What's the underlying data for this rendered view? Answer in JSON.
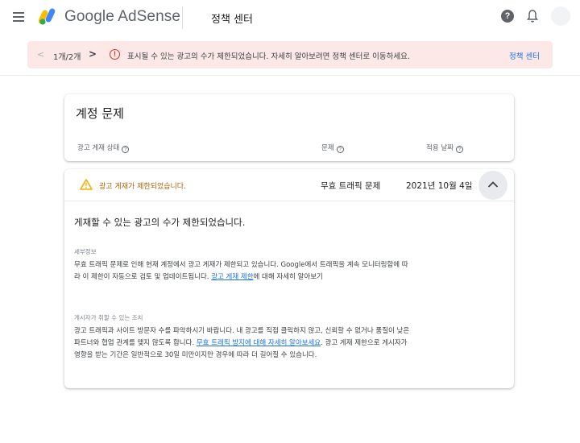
{
  "header": {
    "brand": "Google AdSense",
    "section": "정책 센터"
  },
  "alert": {
    "prev": "<",
    "count": "1개/2개",
    "next": ">",
    "info_symbol": "!",
    "message": "표시될 수 있는 광고의 수가 제한되었습니다. 자세히 알아보려면 정책 센터로 이동하세요.",
    "link": "정책 센터"
  },
  "account_issues": {
    "title": "계정 문제",
    "columns": {
      "status": "광고 게재 상태",
      "issue": "문제",
      "date": "적용 날짜"
    }
  },
  "issue_row": {
    "status": "광고 게재가 제한되었습니다.",
    "issue": "무효 트래픽 문제",
    "date": "2021년 10월 4일"
  },
  "detail": {
    "title": "게재할 수 있는 광고의 수가 제한되었습니다.",
    "section1_label": "세부정보",
    "section1_text_a": "무효 트래픽 문제로 인해 현재 계정에서 광고 게재가 제한되고 있습니다. Google에서 트래픽을 계속 모니터링함에 따라 이 제한이 자동으로 검토 및 업데이트됩니다. ",
    "section1_link": "광고 게재 제한",
    "section1_text_b": "에 대해 자세히 알아보기",
    "section2_label": "게시자가 취할 수 있는 조치",
    "section2_text_a": "광고 트래픽과 사이트 방문자 수를 파악하시기 바랍니다. 내 광고를 직접 클릭하지 않고, 신뢰할 수 없거나 품질이 낮은 파트너와 협업 관계를 맺지 않도록 합니다. ",
    "section2_link": "무효 트래픽 방지에 대해 자세히 알아보세요",
    "section2_text_b": ". 광고 게재 제한으로 게시자가 영향을 받는 기간은 일반적으로 30일 미만이지만 경우에 따라 더 길어질 수 있습니다."
  },
  "colors": {
    "warning": "#f9ab00",
    "warning_text": "#b06000",
    "alert_bg": "#fce8e6",
    "link": "#1a73e8"
  },
  "icons": [
    "menu-icon",
    "adsense-logo",
    "help-icon",
    "bell-icon",
    "info-icon",
    "warning-icon",
    "chevron-up-icon"
  ]
}
